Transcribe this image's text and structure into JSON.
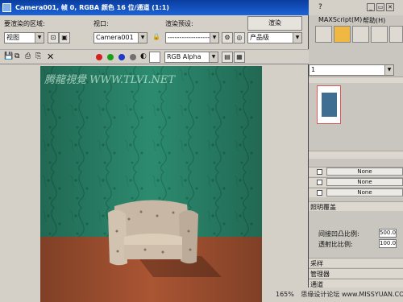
{
  "window": {
    "title": "Camera001, 帧 0, RGBA 颜色 16 位/通道 (1:1)"
  },
  "toolbar": {
    "area_label": "要渲染的区域:",
    "area_value": "视图",
    "viewport_label": "视口:",
    "viewport_value": "Camera001",
    "preset_label": "渲染预设:",
    "preset_value": "-------------------",
    "render_button": "渲染",
    "quality_value": "产品级",
    "channel_value": "RGB Alpha"
  },
  "colors": {
    "red": "#d42020",
    "green": "#19a019",
    "blue": "#2038c8",
    "gray": "#707070"
  },
  "render": {
    "watermark": "腾龍視覺 WWW.TLVI.NET"
  },
  "right_panel": {
    "menu_maxscript": "MAXScript(M)",
    "menu_help": "帮助(H)",
    "dropdown_value": "1",
    "map_slots": [
      "None",
      "None",
      "None"
    ],
    "section_mapping": "照明覆盖",
    "bump_label": "间接凹凸比例:",
    "bump_value": "500.0",
    "refraction_label": "透射比比例:",
    "refraction_value": "100.0",
    "rollout_sampling": "采样",
    "rollout_manager": "管理器",
    "rollout_channel": "通道",
    "zoom": "165%"
  },
  "footer": {
    "text": "思缘设计论坛 www.MISSYUAN.COM"
  }
}
